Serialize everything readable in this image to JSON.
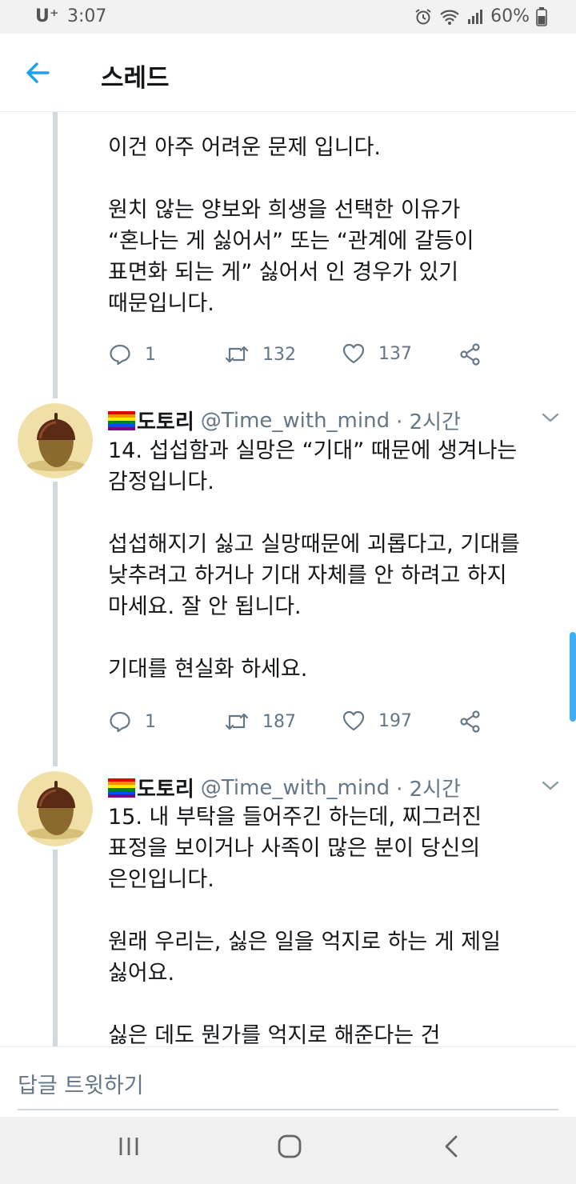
{
  "status_bar": {
    "carrier": "U⁺",
    "time": "3:07",
    "battery": "60%"
  },
  "header": {
    "title": "스레드"
  },
  "tweets": [
    {
      "text": "이건 아주 어려운 문제 입니다.\n\n원치 않는 양보와 희생을 선택한 이유가\n“혼나는 게 싫어서” 또는 “관계에 갈등이\n표면화 되는 게” 싫어서 인 경우가 있기\n때문입니다.",
      "replies": "1",
      "retweets": "132",
      "likes": "137"
    },
    {
      "name": "도토리",
      "handle": "@Time_with_mind",
      "time": "· 2시간",
      "text": "14. 섭섭함과 실망은 “기대” 때문에 생겨나는\n감정입니다.\n\n섭섭해지기 싫고 실망때문에 괴롭다고, 기대를\n낮추려고 하거나 기대 자체를 안 하려고 하지\n마세요. 잘 안 됩니다.\n\n기대를 현실화 하세요.",
      "replies": "1",
      "retweets": "187",
      "likes": "197"
    },
    {
      "name": "도토리",
      "handle": "@Time_with_mind",
      "time": "· 2시간",
      "text": "15. 내 부탁을 들어주긴 하는데, 찌그러진\n표정을 보이거나 사족이 많은 분이 당신의\n은인입니다.\n\n원래 우리는, 싫은 일을 억지로 하는 게 제일\n싫어요.\n\n싫은 데도 뭔가를 억지로 해준다는 건"
    }
  ],
  "reply_bar": {
    "placeholder": "답글 트윗하기"
  },
  "colors": {
    "accent": "#1da1f2",
    "text": "#14171a",
    "muted": "#657786",
    "line": "#cfd9de"
  }
}
